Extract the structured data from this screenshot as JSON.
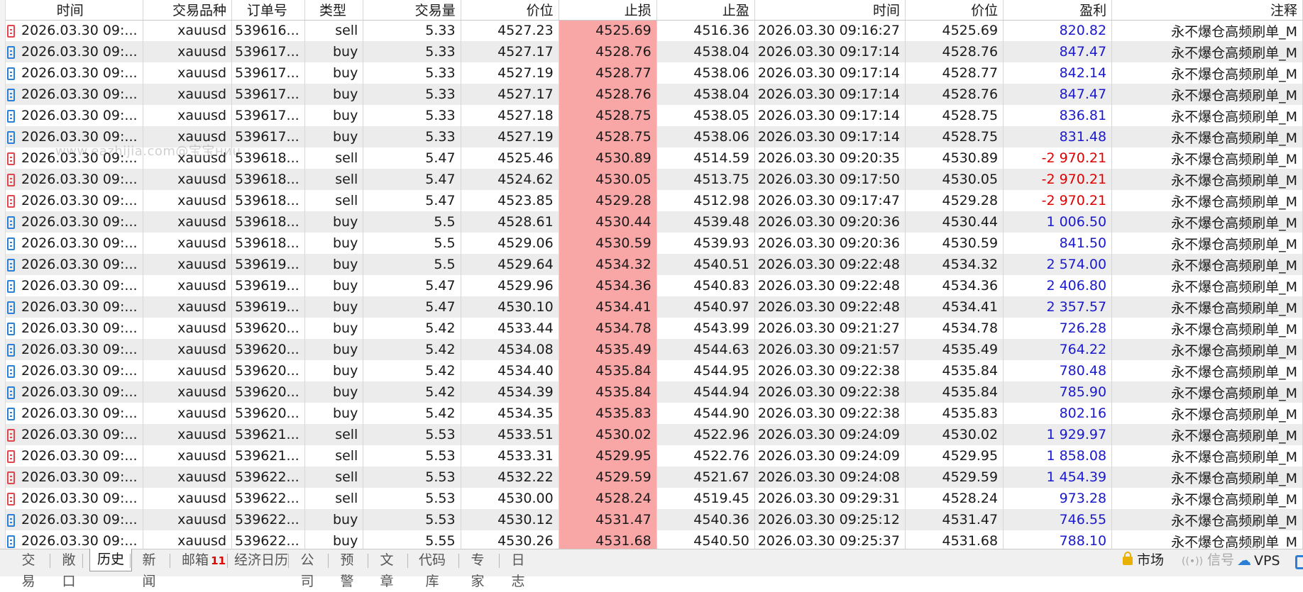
{
  "columns": [
    "时间",
    "交易品种",
    "订单号",
    "类型",
    "交易量",
    "价位",
    "止损",
    "止盈",
    "时间",
    "价位",
    "盈利",
    "注释"
  ],
  "rows": [
    {
      "dir": "sell",
      "time": "2026.03.30 09:...",
      "symbol": "xauusd",
      "order": "539616...",
      "type": "sell",
      "volume": "5.33",
      "price": "4527.23",
      "sl": "4525.69",
      "tp": "4516.36",
      "close_time": "2026.03.30 09:16:27",
      "close_price": "4525.69",
      "profit": "820.82",
      "profit_sign": "pos",
      "comment": "永不爆仓高频刷单_M"
    },
    {
      "dir": "buy",
      "time": "2026.03.30 09:...",
      "symbol": "xauusd",
      "order": "539617...",
      "type": "buy",
      "volume": "5.33",
      "price": "4527.17",
      "sl": "4528.76",
      "tp": "4538.04",
      "close_time": "2026.03.30 09:17:14",
      "close_price": "4528.76",
      "profit": "847.47",
      "profit_sign": "pos",
      "comment": "永不爆仓高频刷单_M"
    },
    {
      "dir": "buy",
      "time": "2026.03.30 09:...",
      "symbol": "xauusd",
      "order": "539617...",
      "type": "buy",
      "volume": "5.33",
      "price": "4527.19",
      "sl": "4528.77",
      "tp": "4538.06",
      "close_time": "2026.03.30 09:17:14",
      "close_price": "4528.77",
      "profit": "842.14",
      "profit_sign": "pos",
      "comment": "永不爆仓高频刷单_M"
    },
    {
      "dir": "buy",
      "time": "2026.03.30 09:...",
      "symbol": "xauusd",
      "order": "539617...",
      "type": "buy",
      "volume": "5.33",
      "price": "4527.17",
      "sl": "4528.76",
      "tp": "4538.04",
      "close_time": "2026.03.30 09:17:14",
      "close_price": "4528.76",
      "profit": "847.47",
      "profit_sign": "pos",
      "comment": "永不爆仓高频刷单_M"
    },
    {
      "dir": "buy",
      "time": "2026.03.30 09:...",
      "symbol": "xauusd",
      "order": "539617...",
      "type": "buy",
      "volume": "5.33",
      "price": "4527.18",
      "sl": "4528.75",
      "tp": "4538.05",
      "close_time": "2026.03.30 09:17:14",
      "close_price": "4528.75",
      "profit": "836.81",
      "profit_sign": "pos",
      "comment": "永不爆仓高频刷单_M"
    },
    {
      "dir": "buy",
      "time": "2026.03.30 09:...",
      "symbol": "xauusd",
      "order": "539617...",
      "type": "buy",
      "volume": "5.33",
      "price": "4527.19",
      "sl": "4528.75",
      "tp": "4538.06",
      "close_time": "2026.03.30 09:17:14",
      "close_price": "4528.75",
      "profit": "831.48",
      "profit_sign": "pos",
      "comment": "永不爆仓高频刷单_M"
    },
    {
      "dir": "sell",
      "time": "2026.03.30 09:...",
      "symbol": "xauusd",
      "order": "539618...",
      "type": "sell",
      "volume": "5.47",
      "price": "4525.46",
      "sl": "4530.89",
      "tp": "4514.59",
      "close_time": "2026.03.30 09:20:35",
      "close_price": "4530.89",
      "profit": "-2 970.21",
      "profit_sign": "neg",
      "comment": "永不爆仓高频刷单_M"
    },
    {
      "dir": "sell",
      "time": "2026.03.30 09:...",
      "symbol": "xauusd",
      "order": "539618...",
      "type": "sell",
      "volume": "5.47",
      "price": "4524.62",
      "sl": "4530.05",
      "tp": "4513.75",
      "close_time": "2026.03.30 09:17:50",
      "close_price": "4530.05",
      "profit": "-2 970.21",
      "profit_sign": "neg",
      "comment": "永不爆仓高频刷单_M"
    },
    {
      "dir": "sell",
      "time": "2026.03.30 09:...",
      "symbol": "xauusd",
      "order": "539618...",
      "type": "sell",
      "volume": "5.47",
      "price": "4523.85",
      "sl": "4529.28",
      "tp": "4512.98",
      "close_time": "2026.03.30 09:17:47",
      "close_price": "4529.28",
      "profit": "-2 970.21",
      "profit_sign": "neg",
      "comment": "永不爆仓高频刷单_M"
    },
    {
      "dir": "buy",
      "time": "2026.03.30 09:...",
      "symbol": "xauusd",
      "order": "539618...",
      "type": "buy",
      "volume": "5.5",
      "price": "4528.61",
      "sl": "4530.44",
      "tp": "4539.48",
      "close_time": "2026.03.30 09:20:36",
      "close_price": "4530.44",
      "profit": "1 006.50",
      "profit_sign": "pos",
      "comment": "永不爆仓高频刷单_M"
    },
    {
      "dir": "buy",
      "time": "2026.03.30 09:...",
      "symbol": "xauusd",
      "order": "539618...",
      "type": "buy",
      "volume": "5.5",
      "price": "4529.06",
      "sl": "4530.59",
      "tp": "4539.93",
      "close_time": "2026.03.30 09:20:36",
      "close_price": "4530.59",
      "profit": "841.50",
      "profit_sign": "pos",
      "comment": "永不爆仓高频刷单_M"
    },
    {
      "dir": "buy",
      "time": "2026.03.30 09:...",
      "symbol": "xauusd",
      "order": "539619...",
      "type": "buy",
      "volume": "5.5",
      "price": "4529.64",
      "sl": "4534.32",
      "tp": "4540.51",
      "close_time": "2026.03.30 09:22:48",
      "close_price": "4534.32",
      "profit": "2 574.00",
      "profit_sign": "pos",
      "comment": "永不爆仓高频刷单_M"
    },
    {
      "dir": "buy",
      "time": "2026.03.30 09:...",
      "symbol": "xauusd",
      "order": "539619...",
      "type": "buy",
      "volume": "5.47",
      "price": "4529.96",
      "sl": "4534.36",
      "tp": "4540.83",
      "close_time": "2026.03.30 09:22:48",
      "close_price": "4534.36",
      "profit": "2 406.80",
      "profit_sign": "pos",
      "comment": "永不爆仓高频刷单_M"
    },
    {
      "dir": "buy",
      "time": "2026.03.30 09:...",
      "symbol": "xauusd",
      "order": "539619...",
      "type": "buy",
      "volume": "5.47",
      "price": "4530.10",
      "sl": "4534.41",
      "tp": "4540.97",
      "close_time": "2026.03.30 09:22:48",
      "close_price": "4534.41",
      "profit": "2 357.57",
      "profit_sign": "pos",
      "comment": "永不爆仓高频刷单_M"
    },
    {
      "dir": "buy",
      "time": "2026.03.30 09:...",
      "symbol": "xauusd",
      "order": "539620...",
      "type": "buy",
      "volume": "5.42",
      "price": "4533.44",
      "sl": "4534.78",
      "tp": "4543.99",
      "close_time": "2026.03.30 09:21:27",
      "close_price": "4534.78",
      "profit": "726.28",
      "profit_sign": "pos",
      "comment": "永不爆仓高频刷单_M"
    },
    {
      "dir": "buy",
      "time": "2026.03.30 09:...",
      "symbol": "xauusd",
      "order": "539620...",
      "type": "buy",
      "volume": "5.42",
      "price": "4534.08",
      "sl": "4535.49",
      "tp": "4544.63",
      "close_time": "2026.03.30 09:21:57",
      "close_price": "4535.49",
      "profit": "764.22",
      "profit_sign": "pos",
      "comment": "永不爆仓高频刷单_M"
    },
    {
      "dir": "buy",
      "time": "2026.03.30 09:...",
      "symbol": "xauusd",
      "order": "539620...",
      "type": "buy",
      "volume": "5.42",
      "price": "4534.40",
      "sl": "4535.84",
      "tp": "4544.95",
      "close_time": "2026.03.30 09:22:38",
      "close_price": "4535.84",
      "profit": "780.48",
      "profit_sign": "pos",
      "comment": "永不爆仓高频刷单_M"
    },
    {
      "dir": "buy",
      "time": "2026.03.30 09:...",
      "symbol": "xauusd",
      "order": "539620...",
      "type": "buy",
      "volume": "5.42",
      "price": "4534.39",
      "sl": "4535.84",
      "tp": "4544.94",
      "close_time": "2026.03.30 09:22:38",
      "close_price": "4535.84",
      "profit": "785.90",
      "profit_sign": "pos",
      "comment": "永不爆仓高频刷单_M"
    },
    {
      "dir": "buy",
      "time": "2026.03.30 09:...",
      "symbol": "xauusd",
      "order": "539620...",
      "type": "buy",
      "volume": "5.42",
      "price": "4534.35",
      "sl": "4535.83",
      "tp": "4544.90",
      "close_time": "2026.03.30 09:22:38",
      "close_price": "4535.83",
      "profit": "802.16",
      "profit_sign": "pos",
      "comment": "永不爆仓高频刷单_M"
    },
    {
      "dir": "sell",
      "time": "2026.03.30 09:...",
      "symbol": "xauusd",
      "order": "539621...",
      "type": "sell",
      "volume": "5.53",
      "price": "4533.51",
      "sl": "4530.02",
      "tp": "4522.96",
      "close_time": "2026.03.30 09:24:09",
      "close_price": "4530.02",
      "profit": "1 929.97",
      "profit_sign": "pos",
      "comment": "永不爆仓高频刷单_M"
    },
    {
      "dir": "sell",
      "time": "2026.03.30 09:...",
      "symbol": "xauusd",
      "order": "539621...",
      "type": "sell",
      "volume": "5.53",
      "price": "4533.31",
      "sl": "4529.95",
      "tp": "4522.76",
      "close_time": "2026.03.30 09:24:09",
      "close_price": "4529.95",
      "profit": "1 858.08",
      "profit_sign": "pos",
      "comment": "永不爆仓高频刷单_M"
    },
    {
      "dir": "sell",
      "time": "2026.03.30 09:...",
      "symbol": "xauusd",
      "order": "539622...",
      "type": "sell",
      "volume": "5.53",
      "price": "4532.22",
      "sl": "4529.59",
      "tp": "4521.67",
      "close_time": "2026.03.30 09:24:08",
      "close_price": "4529.59",
      "profit": "1 454.39",
      "profit_sign": "pos",
      "comment": "永不爆仓高频刷单_M"
    },
    {
      "dir": "sell",
      "time": "2026.03.30 09:...",
      "symbol": "xauusd",
      "order": "539622...",
      "type": "sell",
      "volume": "5.53",
      "price": "4530.00",
      "sl": "4528.24",
      "tp": "4519.45",
      "close_time": "2026.03.30 09:29:31",
      "close_price": "4528.24",
      "profit": "973.28",
      "profit_sign": "pos",
      "comment": "永不爆仓高频刷单_M"
    },
    {
      "dir": "buy",
      "time": "2026.03.30 09:...",
      "symbol": "xauusd",
      "order": "539622...",
      "type": "buy",
      "volume": "5.53",
      "price": "4530.12",
      "sl": "4531.47",
      "tp": "4540.36",
      "close_time": "2026.03.30 09:25:12",
      "close_price": "4531.47",
      "profit": "746.55",
      "profit_sign": "pos",
      "comment": "永不爆仓高频刷单_M"
    },
    {
      "dir": "buy",
      "time": "2026.03.30 09:...",
      "symbol": "xauusd",
      "order": "539622...",
      "type": "buy",
      "volume": "5.55",
      "price": "4530.26",
      "sl": "4531.68",
      "tp": "4540.50",
      "close_time": "2026.03.30 09:25:37",
      "close_price": "4531.68",
      "profit": "788.10",
      "profit_sign": "pos",
      "comment": "永不爆仓高频刷单_M"
    }
  ],
  "watermark": "www.eazhijia.com@宝宝ниu",
  "tabs": [
    {
      "label": "交易",
      "active": false
    },
    {
      "label": "敞口",
      "active": false
    },
    {
      "label": "历史",
      "active": true
    },
    {
      "label": "新闻",
      "active": false
    },
    {
      "label": "邮箱",
      "active": false,
      "badge": "11"
    },
    {
      "label": "经济日历",
      "active": false
    },
    {
      "label": "公司",
      "active": false
    },
    {
      "label": "预警",
      "active": false
    },
    {
      "label": "文章",
      "active": false
    },
    {
      "label": "代码库",
      "active": false
    },
    {
      "label": "专家",
      "active": false
    },
    {
      "label": "日志",
      "active": false
    }
  ],
  "status": {
    "market": "市场",
    "signal": "信号",
    "vps": "VPS"
  },
  "colors": {
    "stoploss_bg": "#f9a6a6",
    "profit_pos": "#1a1acc",
    "profit_neg": "#e00000",
    "sell_icon": "#e0474c",
    "buy_icon": "#2b7fd4"
  }
}
